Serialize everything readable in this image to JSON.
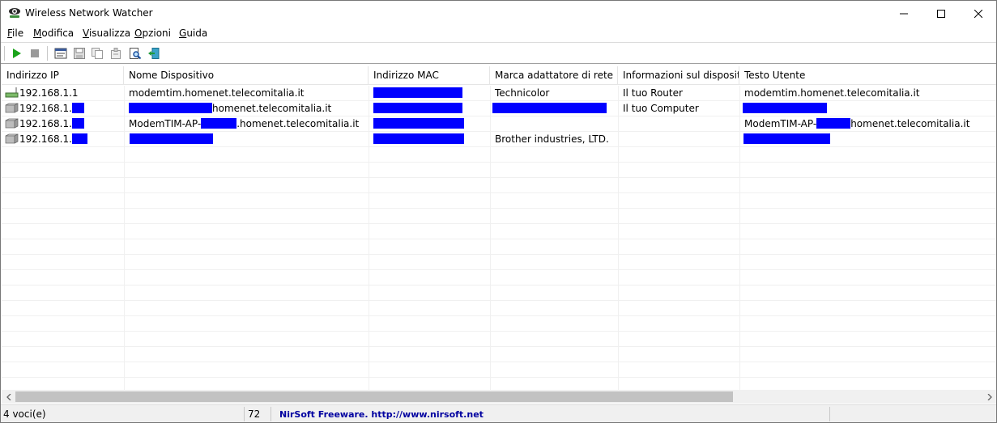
{
  "window": {
    "title": "Wireless Network Watcher",
    "app_icon": "eye-icon"
  },
  "menu": {
    "items": [
      {
        "label": "File",
        "accel": "F"
      },
      {
        "label": "Modifica",
        "accel": "M"
      },
      {
        "label": "Visualizza",
        "accel": "V"
      },
      {
        "label": "Opzioni",
        "accel": "O"
      },
      {
        "label": "Guida",
        "accel": "G"
      }
    ]
  },
  "toolbar": {
    "buttons": [
      "start-scan-icon",
      "stop-scan-icon",
      "html-report-icon",
      "save-icon",
      "copy-icon",
      "properties-icon",
      "find-icon",
      "exit-icon"
    ]
  },
  "table": {
    "columns": [
      "Indirizzo IP",
      "Nome Dispositivo",
      "Indirizzo MAC",
      "Marca adattatore di rete",
      "Informazioni sul disposit...",
      "Testo Utente"
    ],
    "rows": [
      {
        "icon": "router-icon",
        "ip": "192.168.1.1",
        "name": "modemtim.homenet.telecomitalia.it",
        "mac": "",
        "brand": "Technicolor",
        "info": "Il tuo Router",
        "user_text": "modemtim.homenet.telecomitalia.it"
      },
      {
        "icon": "computer-icon",
        "ip": "192.168.1.",
        "name_suffix": "homenet.telecomitalia.it",
        "mac": "",
        "brand": "",
        "info": "Il tuo Computer",
        "user_text": ""
      },
      {
        "icon": "network-device-icon",
        "ip": "192.168.1.",
        "name_prefix": "ModemTIM-AP-",
        "name_suffix": ".homenet.telecomitalia.it",
        "mac": "",
        "brand": "",
        "info": "",
        "user_text_prefix": "ModemTIM-AP-",
        "user_text_suffix": "homenet.telecomitalia.it"
      },
      {
        "icon": "network-device-icon",
        "ip": "192.168.1.",
        "name": "",
        "mac": "",
        "brand": "Brother industries, LTD.",
        "info": "",
        "user_text": ""
      }
    ]
  },
  "statusbar": {
    "count": "4 voci(e)",
    "value": "72",
    "link": "NirSoft Freeware.  http://www.nirsoft.net"
  },
  "colors": {
    "redaction": "#0000ff",
    "link": "#0000a0"
  }
}
